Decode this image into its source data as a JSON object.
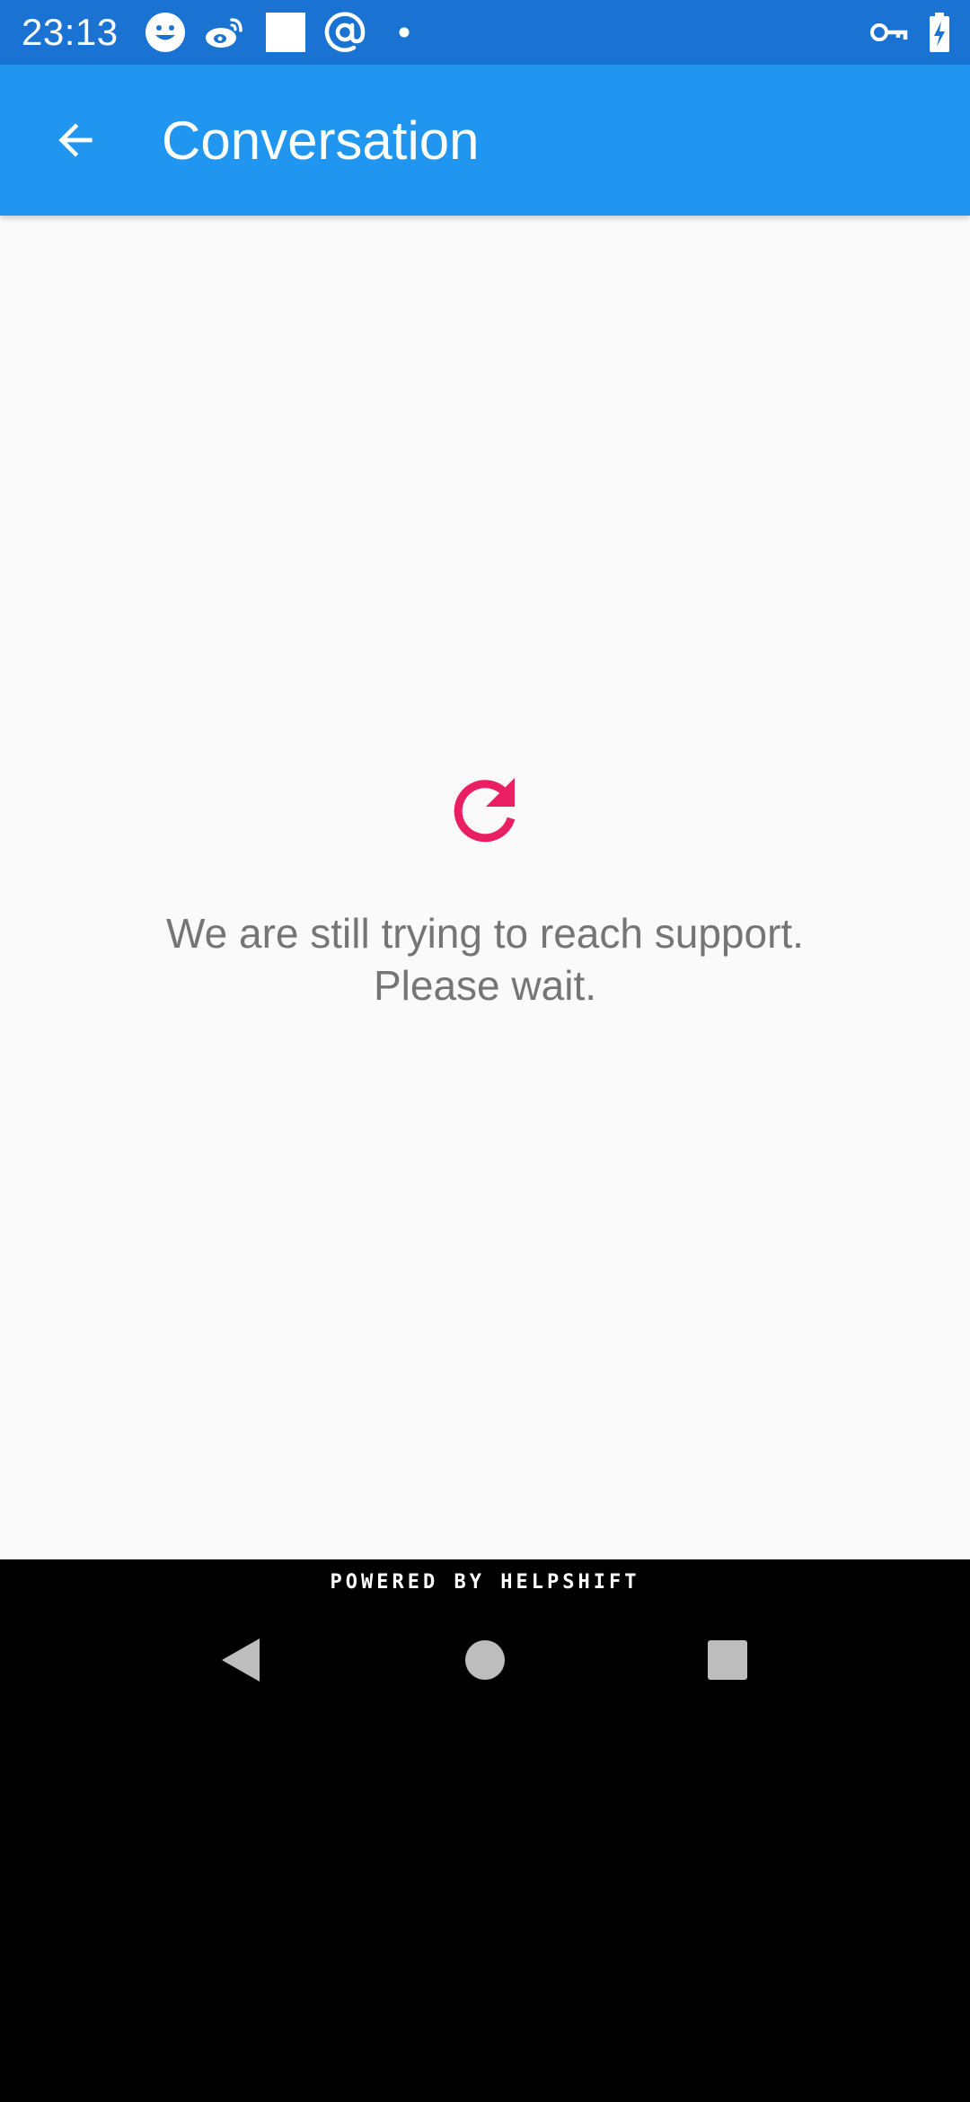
{
  "status_bar": {
    "time": "23:13",
    "left_icons": [
      "smiley-icon",
      "weibo-icon",
      "square-notification-icon",
      "at-sign-icon",
      "dot-icon"
    ],
    "right_icons": [
      "vpn-key-icon",
      "battery-charging-icon"
    ]
  },
  "app_bar": {
    "back_icon": "arrow-back-icon",
    "title": "Conversation"
  },
  "main": {
    "retry_icon": "refresh-icon",
    "message_line1": "We are still trying to reach support.",
    "message_line2": "Please wait."
  },
  "footer": {
    "powered_by": "POWERED BY HELPSHIFT"
  },
  "nav_bar": {
    "icons": [
      "nav-back-icon",
      "nav-home-icon",
      "nav-recents-icon"
    ]
  },
  "colors": {
    "status_bar": "#1a73d2",
    "app_bar": "#2196f0",
    "accent": "#e91e63",
    "background": "#fafafa",
    "message_text": "#757575"
  }
}
